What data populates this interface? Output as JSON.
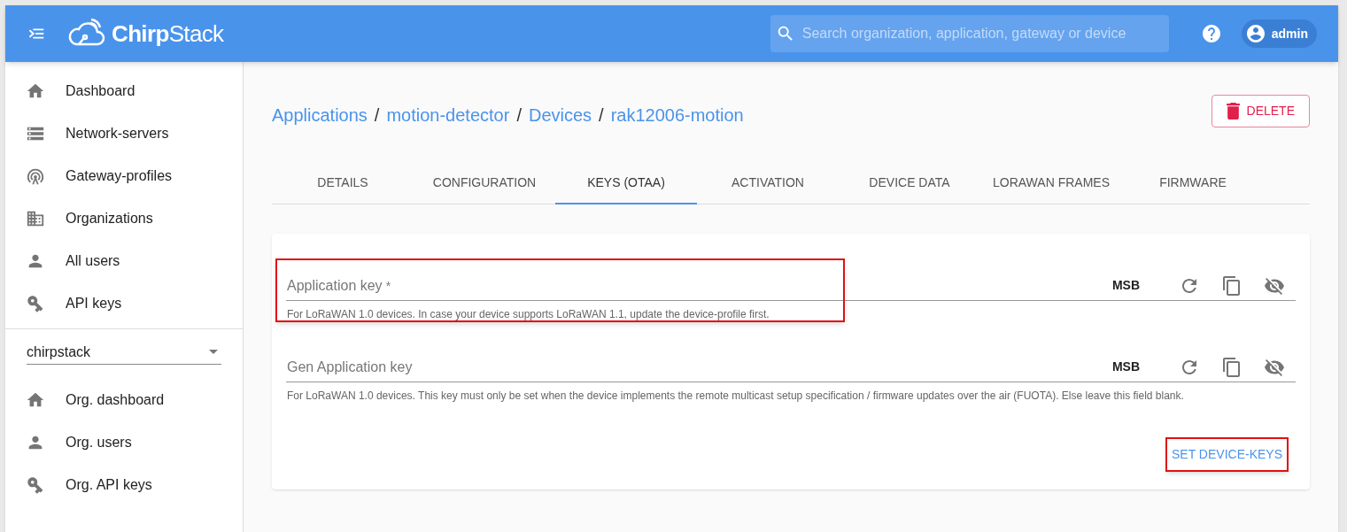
{
  "header": {
    "logo": "**Chirp**Stack",
    "search": {
      "placeholder": "Search organization, application, gateway or device"
    },
    "user": "admin"
  },
  "sidebar": {
    "items": [
      {
        "label": "Dashboard"
      },
      {
        "label": "Network-servers"
      },
      {
        "label": "Gateway-profiles"
      },
      {
        "label": "Organizations"
      },
      {
        "label": "All users"
      },
      {
        "label": "API keys"
      }
    ],
    "organization_select": {
      "value": "chirpstack"
    },
    "org_items": [
      {
        "label": "Org. dashboard"
      },
      {
        "label": "Org. users"
      },
      {
        "label": "Org. API keys"
      }
    ]
  },
  "breadcrumb": [
    {
      "kind": "link",
      "text": "Applications"
    },
    {
      "kind": "separator",
      "text": "/"
    },
    {
      "kind": "link",
      "text": "motion-detector"
    },
    {
      "kind": "separator",
      "text": "/"
    },
    {
      "kind": "link",
      "text": "Devices"
    },
    {
      "kind": "separator",
      "text": "/"
    },
    {
      "kind": "current",
      "text": "rak12006-motion"
    }
  ],
  "delete_button": "DELETE",
  "tabs": [
    {
      "label": "DETAILS",
      "selected": false
    },
    {
      "label": "CONFIGURATION",
      "selected": false
    },
    {
      "label": "KEYS (OTAA)",
      "selected": true
    },
    {
      "label": "ACTIVATION",
      "selected": false
    },
    {
      "label": "DEVICE DATA",
      "selected": false
    },
    {
      "label": "LORAWAN FRAMES",
      "selected": false
    },
    {
      "label": "FIRMWARE",
      "selected": false
    }
  ],
  "fields": [
    {
      "label": "Application key",
      "required_mark": "*",
      "byte_order": "MSB",
      "hint": "For LoRaWAN 1.0 devices. In case your device supports LoRaWAN 1.1, update the device-profile first.",
      "highlighted": true
    },
    {
      "label": "Gen Application key",
      "byte_order": "MSB",
      "hint": "For LoRaWAN 1.0 devices. This key must only be set when the device implements the remote multicast setup specification / firmware updates over the air (FUOTA). Else leave this field blank.",
      "highlighted": false
    }
  ],
  "submit_button": {
    "label": "SET DEVICE-KEYS",
    "highlighted": true
  }
}
